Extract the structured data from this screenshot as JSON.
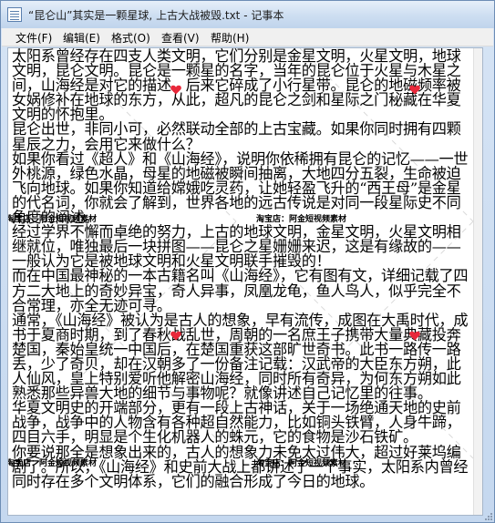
{
  "window": {
    "title": "“昆仑山”其实是一颗星球, 上古大战被毁.txt - 记事本"
  },
  "menu": {
    "file": "文件(F)",
    "edit": "编辑(E)",
    "format": "格式(O)",
    "view": "查看(V)",
    "help": "帮助(H)"
  },
  "content": {
    "paragraphs": [
      "太阳系曾经存在四支人类文明，它们分别是金星文明，火星文明，地球文明，昆仑文明。昆仑是一颗星的名字，当年的昆仑位于火星与木星之间，山海经是对它的描述，后来它碎成了小行星带。昆仑的地磁频率被女娲修补在地球的东方，从此，超凡的昆仑之剑和星际之门秘藏在华夏文明的怀抱里。",
      "昆仑出世，非同小可，必然联动全部的上古宝藏。如果你同时拥有四颗星辰之力，会用它来做什么？",
      "如果你看过《超人》和《山海经》，说明你依稀拥有昆仑的记忆——一世外桃源，绿色水晶，母星的地磁被瞬间抽离，大地四分五裂，生命被迫飞向地球。如果你知道给嫦娥吃灵药，让她轻盈飞升的“西王母”是金星的代名词，你就会了解到，世界各地的远古传说是对同一段星际史不同角度的阐述。",
      "经过学界不懈而卓绝的努力，上古的地球文明，金星文明，火星文明相继就位，唯独最后一块拼图——昆仑之星姗姗来迟，这是有缘故的——一般认为它是被地球文明和火星文明联手摧毁的！",
      "而在中国最神秘的一本古籍名叫《山海经》，它有图有文，详细记载了四方二大地上的奇妙异宝，奇人异事，凤凰龙龟，鱼人鸟人，似乎完全不合常理，亦全无迹可寻。",
      "通常，《山海经》被认为是古人的想象，早有流传，成图在大禹时代，成书于夏商时期，到了春秋战乱世，周朝的一名庶王子携带大量典藏投奔楚国，秦始皇统一中国后，在楚国重获这部旷世奇书。此书一路传一路丢，少了奇贝，却在汉朝多了一份备注记载：汉武帝的大臣东方朔，此人仙风，皇上特别爱听他解密山海经，同时所有奇异，为何东方朔如此熟悉那些异兽大地的细节与事物呢？就像讲述自己记忆里的往事。",
      "华夏文明史的开端部分，更有一段上古神话，关于一场绝通天地的史前战争，战争中的人物含有各种超自然能力，比如铜头铁臂，人身牛蹄，四目六手，明显是个生化机器人的蛛元，它的食物是沙石铁矿。",
      "你要说那全是想象出来的，古人的想象力未免太过伟大，超过好莱坞编剧了。所以，《山海经》和史前大战上都讲述了一个事实，太阳系内曾经同时存在多个文明体系，它们的融合形成了今日的地球。"
    ]
  },
  "watermarks": [
    "淘宝店：阿金短视频素材",
    "淘宝店：阿金短视频素材",
    "淘宝店：阿金短视频素材",
    "淘宝店：阿金短视频素材"
  ],
  "icons": {
    "app": "notepad-icon",
    "heart": "heart-icon"
  },
  "colors": {
    "heart": "#e8283a",
    "titlebar": "#cfdff2",
    "text": "#000000"
  }
}
